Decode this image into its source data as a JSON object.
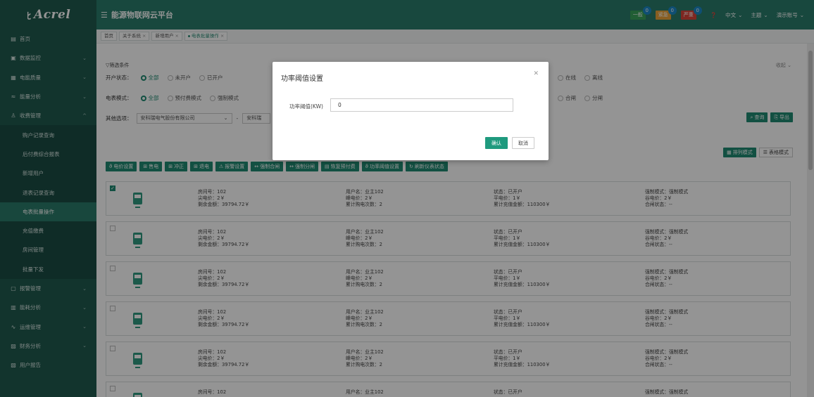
{
  "app": {
    "logo": "Acrel",
    "platform_title": "能源物联网云平台"
  },
  "header": {
    "alarms": [
      {
        "label": "一般",
        "count": "0",
        "color": "#3aa35a"
      },
      {
        "label": "紧急",
        "count": "0",
        "color": "#e8a23a"
      },
      {
        "label": "严重",
        "count": "0",
        "color": "#d9443a"
      }
    ],
    "lang": "中文",
    "theme": "主题",
    "account": "演示账号"
  },
  "sidebar": {
    "items": [
      {
        "label": "首页",
        "icon": "home-icon"
      },
      {
        "label": "数据监控",
        "icon": "monitor-icon"
      },
      {
        "label": "电能质量",
        "icon": "quality-icon"
      },
      {
        "label": "能量分析",
        "icon": "analysis-icon"
      },
      {
        "label": "收费管理",
        "icon": "user-icon"
      }
    ],
    "sub_items": [
      "购户记录查询",
      "后付费综合报表",
      "新增用户",
      "退表记录查询",
      "电表批量操作",
      "充值缴费",
      "房间管理",
      "批量下发"
    ],
    "items_after": [
      {
        "label": "报警管理",
        "icon": "alarm-icon"
      },
      {
        "label": "能耗分析",
        "icon": "chart-icon"
      },
      {
        "label": "运维管理",
        "icon": "maintenance-icon"
      },
      {
        "label": "财务分析",
        "icon": "finance-icon"
      },
      {
        "label": "用户报告",
        "icon": "report-icon"
      }
    ]
  },
  "tabs": [
    "首页",
    "关于系统",
    "新增用户",
    "电表批量操作"
  ],
  "filter": {
    "title": "筛选条件",
    "collapse": "收起",
    "row1_label": "开户状态：",
    "row1_options": [
      "全部",
      "未开户",
      "已开户"
    ],
    "row1_right": [
      "在线",
      "离线"
    ],
    "row2_label": "电表模式：",
    "row2_options": [
      "全部",
      "预付费模式",
      "强制模式"
    ],
    "row2_right": [
      "合闸",
      "分闸"
    ],
    "row3_label": "其他选项：",
    "company": "安科瑞电气股份有限公司",
    "company2": "安科瑞",
    "query": "查询",
    "export": "导出"
  },
  "view": {
    "list_mode": "排列模式",
    "table_mode": "表格模式"
  },
  "actions": [
    "电价设置",
    "售电",
    "冲正",
    "退电",
    "报警设置",
    "强制合闸",
    "强制分闸",
    "恢复预付费",
    "功率阈值设置",
    "刷新仪表状态"
  ],
  "cards": [
    {
      "checked": true,
      "room": "房间号：102",
      "tip": "尖电价：2￥",
      "balance": "剩余金额：39794.72￥",
      "user": "用户名：业主102",
      "valley": "峰电价：2￥",
      "times": "累计购电次数：2",
      "status": "状态：已开户",
      "flat": "平电价：1￥",
      "total": "累计充值金额：110300￥",
      "mode": "强制模式：强制模式",
      "gu": "谷电价：2￥",
      "gate": "合闸状态：--"
    },
    {
      "checked": false,
      "room": "房间号：102",
      "tip": "尖电价：2￥",
      "balance": "剩余金额：39794.72￥",
      "user": "用户名：业主102",
      "valley": "峰电价：2￥",
      "times": "累计购电次数：2",
      "status": "状态：已开户",
      "flat": "平电价：1￥",
      "total": "累计充值金额：110300￥",
      "mode": "强制模式：强制模式",
      "gu": "谷电价：2￥",
      "gate": "合闸状态：--"
    },
    {
      "checked": false,
      "room": "房间号：102",
      "tip": "尖电价：2￥",
      "balance": "剩余金额：39794.72￥",
      "user": "用户名：业主102",
      "valley": "峰电价：2￥",
      "times": "累计购电次数：2",
      "status": "状态：已开户",
      "flat": "平电价：1￥",
      "total": "累计充值金额：110300￥",
      "mode": "强制模式：强制模式",
      "gu": "谷电价：2￥",
      "gate": "合闸状态：--"
    },
    {
      "checked": false,
      "room": "房间号：102",
      "tip": "尖电价：2￥",
      "balance": "剩余金额：39794.72￥",
      "user": "用户名：业主102",
      "valley": "峰电价：2￥",
      "times": "累计购电次数：2",
      "status": "状态：已开户",
      "flat": "平电价：1￥",
      "total": "累计充值金额：110300￥",
      "mode": "强制模式：强制模式",
      "gu": "谷电价：2￥",
      "gate": "合闸状态：--"
    },
    {
      "checked": false,
      "room": "房间号：102",
      "tip": "尖电价：2￥",
      "balance": "剩余金额：39794.72￥",
      "user": "用户名：业主102",
      "valley": "峰电价：2￥",
      "times": "累计购电次数：2",
      "status": "状态：已开户",
      "flat": "平电价：1￥",
      "total": "累计充值金额：110300￥",
      "mode": "强制模式：强制模式",
      "gu": "谷电价：2￥",
      "gate": "合闸状态：--"
    },
    {
      "checked": false,
      "room": "房间号：102",
      "tip": "",
      "balance": "",
      "user": "用户名：业主102",
      "valley": "",
      "times": "",
      "status": "状态：已开户",
      "flat": "",
      "total": "",
      "mode": "强制模式：强制模式",
      "gu": "",
      "gate": ""
    }
  ],
  "modal": {
    "title": "功率阈值设置",
    "label": "功率阈值(KW)",
    "value": "0",
    "ok": "确认",
    "cancel": "取消"
  }
}
